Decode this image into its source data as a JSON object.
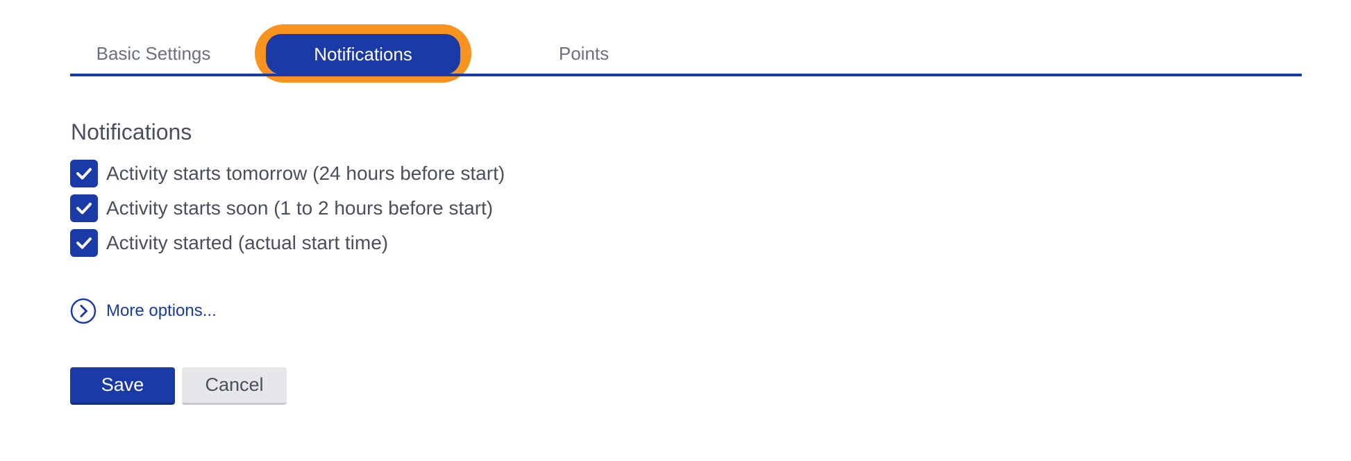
{
  "tabs": {
    "basic_settings": "Basic Settings",
    "notifications": "Notifications",
    "points": "Points",
    "active": "Notifications"
  },
  "notifications": {
    "title": "Notifications",
    "options": [
      {
        "label": "Activity starts tomorrow (24 hours before start)",
        "checked": true
      },
      {
        "label": "Activity starts soon (1 to 2 hours before start)",
        "checked": true
      },
      {
        "label": "Activity started (actual start time)",
        "checked": true
      }
    ],
    "more_options": "More options..."
  },
  "actions": {
    "save": "Save",
    "cancel": "Cancel"
  },
  "colors": {
    "primary": "#1a3aa8",
    "highlight": "#f7931e",
    "text": "#4a4f5c",
    "cancel_bg": "#e6e7eb"
  },
  "icons": {
    "checkbox": "checkmark-icon",
    "more_options": "chevron-right-circle-icon"
  }
}
